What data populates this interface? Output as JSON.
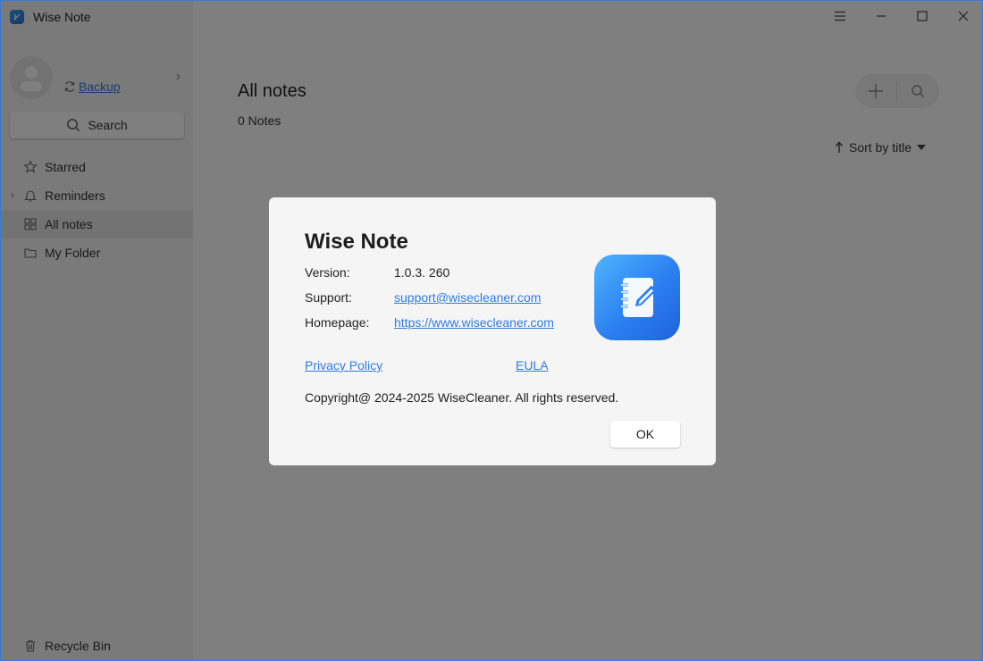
{
  "app": {
    "title": "Wise Note"
  },
  "sidebar": {
    "backup_label": "Backup",
    "search_label": "Search",
    "items": [
      {
        "label": "Starred"
      },
      {
        "label": "Reminders"
      },
      {
        "label": "All notes"
      },
      {
        "label": "My Folder"
      }
    ],
    "recycle_label": "Recycle Bin"
  },
  "main": {
    "title": "All notes",
    "count": "0 Notes",
    "sort_label": "Sort by title"
  },
  "about_dialog": {
    "title": "Wise Note",
    "version_label": "Version:",
    "version_value": "1.0.3. 260",
    "support_label": "Support:",
    "support_value": "support@wisecleaner.com",
    "homepage_label": "Homepage:",
    "homepage_value": "https://www.wisecleaner.com",
    "privacy_label": "Privacy Policy",
    "eula_label": "EULA",
    "copyright": "Copyright@ 2024-2025 WiseCleaner. All rights reserved.",
    "ok_label": "OK"
  },
  "colors": {
    "accent": "#2f7be0",
    "logo_gradient_start": "#4fb4ff",
    "logo_gradient_end": "#1f63d9"
  },
  "icons": {
    "app": "wise-note-logo-icon",
    "backup": "sync-icon",
    "search": "search-icon",
    "starred": "star-icon",
    "reminders": "bell-icon",
    "all_notes": "grid-icon",
    "folder": "folder-icon",
    "recycle": "trash-icon",
    "add": "plus-icon",
    "menu": "hamburger-icon",
    "sort": "arrow-up-icon"
  }
}
